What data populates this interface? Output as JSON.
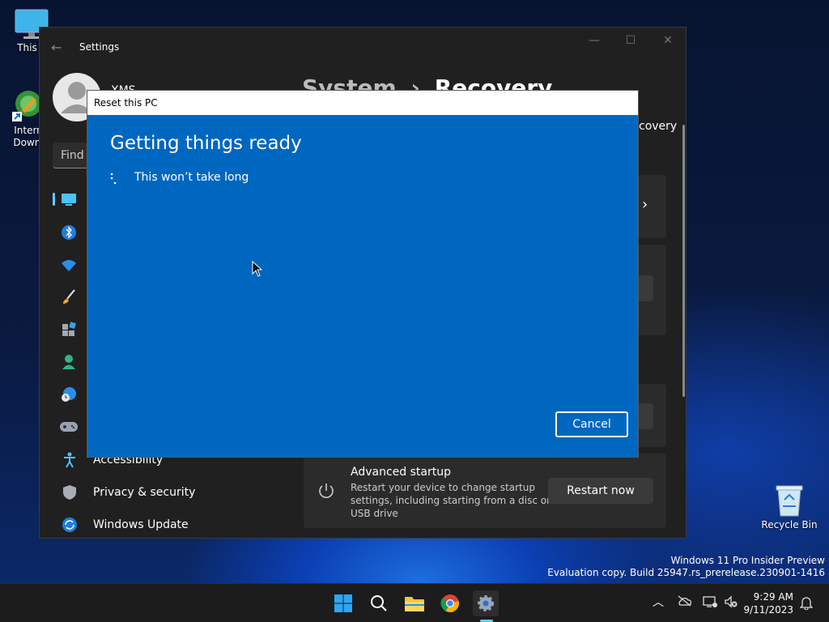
{
  "desktop": {
    "this_pc_label": "This P",
    "idm_label_1": "Intern",
    "idm_label_2": "Downl",
    "recycle_bin_label": "Recycle Bin",
    "watermark_line1": "Windows 11 Pro Insider Preview",
    "watermark_line2": "Evaluation copy. Build 25947.rs_prerelease.230901-1416"
  },
  "settings": {
    "window_title": "Settings",
    "user_name": "XMS",
    "breadcrumb_system": "System",
    "breadcrumb_sep": "›",
    "breadcrumb_page": "Recovery",
    "search_placeholder": "Find a",
    "right_partial_text": "covery",
    "nav": [
      {
        "label": "Accessibility",
        "icon": "accessibility-icon"
      },
      {
        "label": "Privacy & security",
        "icon": "shield-icon"
      },
      {
        "label": "Windows Update",
        "icon": "update-icon"
      }
    ],
    "advanced_startup": {
      "title": "Advanced startup",
      "description_1": "Restart your device to change startup",
      "description_2": "settings, including starting from a disc or",
      "description_3": "USB drive",
      "button": "Restart now"
    }
  },
  "dialog": {
    "title": "Reset this PC",
    "heading": "Getting things ready",
    "status": "This won’t take long",
    "cancel_label": "Cancel"
  },
  "taskbar": {
    "time": "9:29 AM",
    "date": "9/11/2023",
    "apps": [
      "start-icon",
      "search-icon",
      "file-explorer-icon",
      "chrome-icon",
      "settings-icon"
    ]
  },
  "colors": {
    "dialog_blue": "#0067c0",
    "window_bg": "#202020",
    "accent": "#60cdff"
  }
}
